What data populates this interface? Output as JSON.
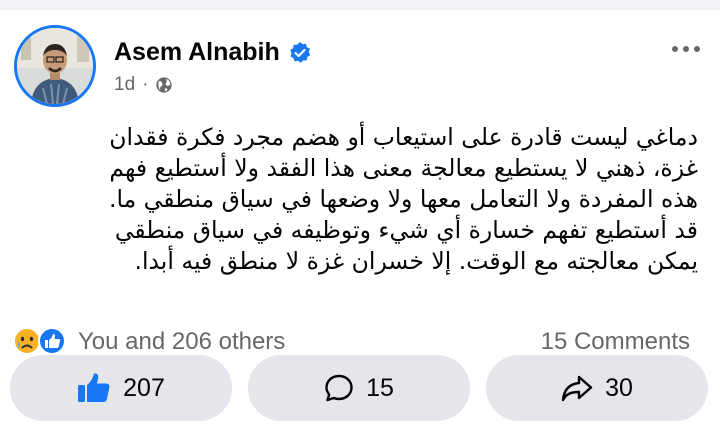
{
  "post": {
    "author": "Asem Alnabih",
    "time": "1d",
    "separator": "·",
    "text": "دماغي ليست قادرة على استيعاب أو هضم مجرد فكرة فقدان\nغزة، ذهني لا يستطيع معالجة معنى هذا الفقد ولا أستطيع فهم\nهذه المفردة ولا التعامل معها ولا وضعها في سياق منطقي ما.\nقد أستطيع تفهم خسارة أي شيء وتوظيفه في سياق منطقي\nيمكن معالجته مع الوقت. إلا خسران غزة لا منطق فيه أبدا."
  },
  "reactions": {
    "summary": "You and 206 others",
    "comments": "15 Comments"
  },
  "actions": {
    "likes": "207",
    "comments": "15",
    "shares": "30"
  },
  "colors": {
    "accent": "#1877f2",
    "background": "#f0f2f5",
    "pill": "#e4e6eb",
    "muted": "#65676b"
  },
  "icons": [
    "verified-badge-icon",
    "globe-icon",
    "more-icon",
    "sad-reaction-icon",
    "like-reaction-icon",
    "thumbs-up-icon",
    "comment-icon",
    "share-icon"
  ]
}
